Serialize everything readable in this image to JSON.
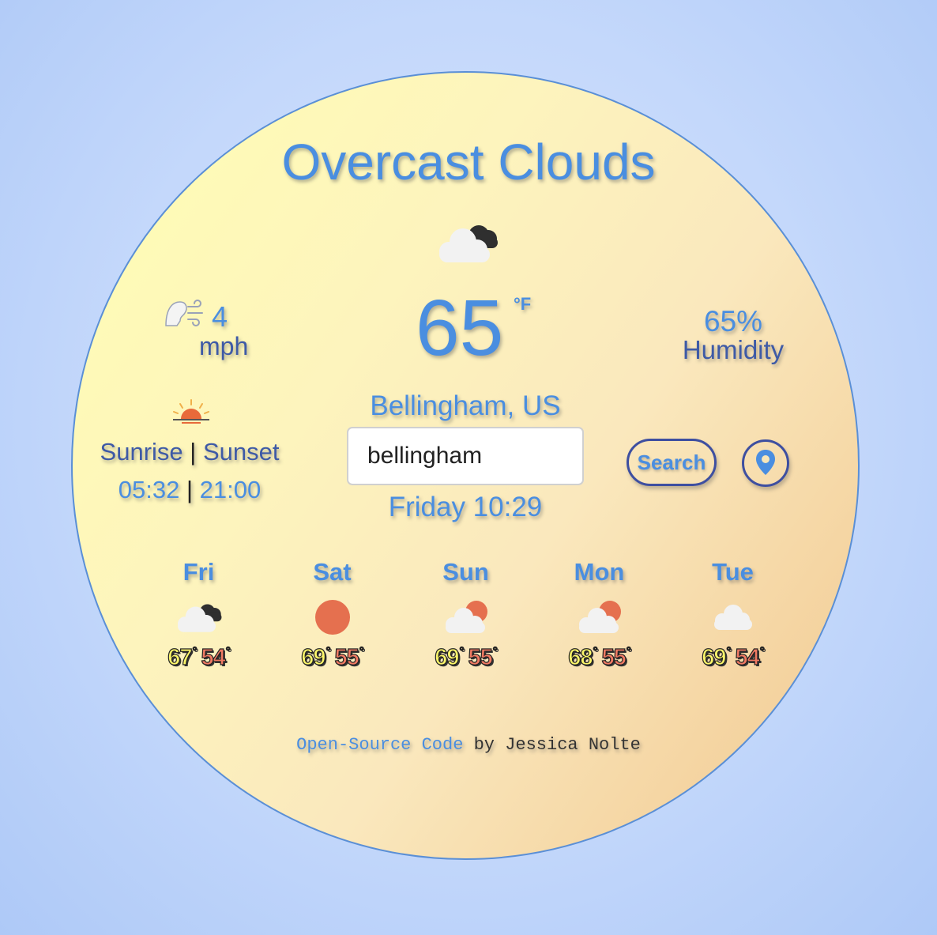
{
  "weather": {
    "description": "Overcast Clouds",
    "main_icon": "overcast-cloud-icon",
    "temperature": "65",
    "temp_unit": "°F",
    "wind_speed": "4",
    "wind_unit": "mph",
    "humidity_pct": "65%",
    "humidity_label": "Humidity",
    "sunrise_label": "Sunrise",
    "sunset_label": "Sunset",
    "separator": "|",
    "sunrise_time": "05:32",
    "sunset_time": "21:00",
    "location": "Bellingham, US",
    "datetime": "Friday 10:29"
  },
  "search": {
    "value": "bellingham",
    "button_label": "Search"
  },
  "forecast": [
    {
      "day": "Fri",
      "icon": "overcast-cloud-icon",
      "high": "67",
      "low": "54"
    },
    {
      "day": "Sat",
      "icon": "sun-icon",
      "high": "69",
      "low": "55"
    },
    {
      "day": "Sun",
      "icon": "partly-cloudy-icon",
      "high": "69",
      "low": "55"
    },
    {
      "day": "Mon",
      "icon": "partly-cloudy-icon",
      "high": "68",
      "low": "55"
    },
    {
      "day": "Tue",
      "icon": "cloud-icon",
      "high": "69",
      "low": "54"
    }
  ],
  "degree_symbol": "°",
  "footer": {
    "link_text": "Open-Source Code",
    "byline": "by Jessica Nolte"
  },
  "colors": {
    "accent": "#4a8ee0",
    "secondary": "#3e5aa6",
    "high_temp": "#fcf66a",
    "low_temp": "#f07a63"
  }
}
